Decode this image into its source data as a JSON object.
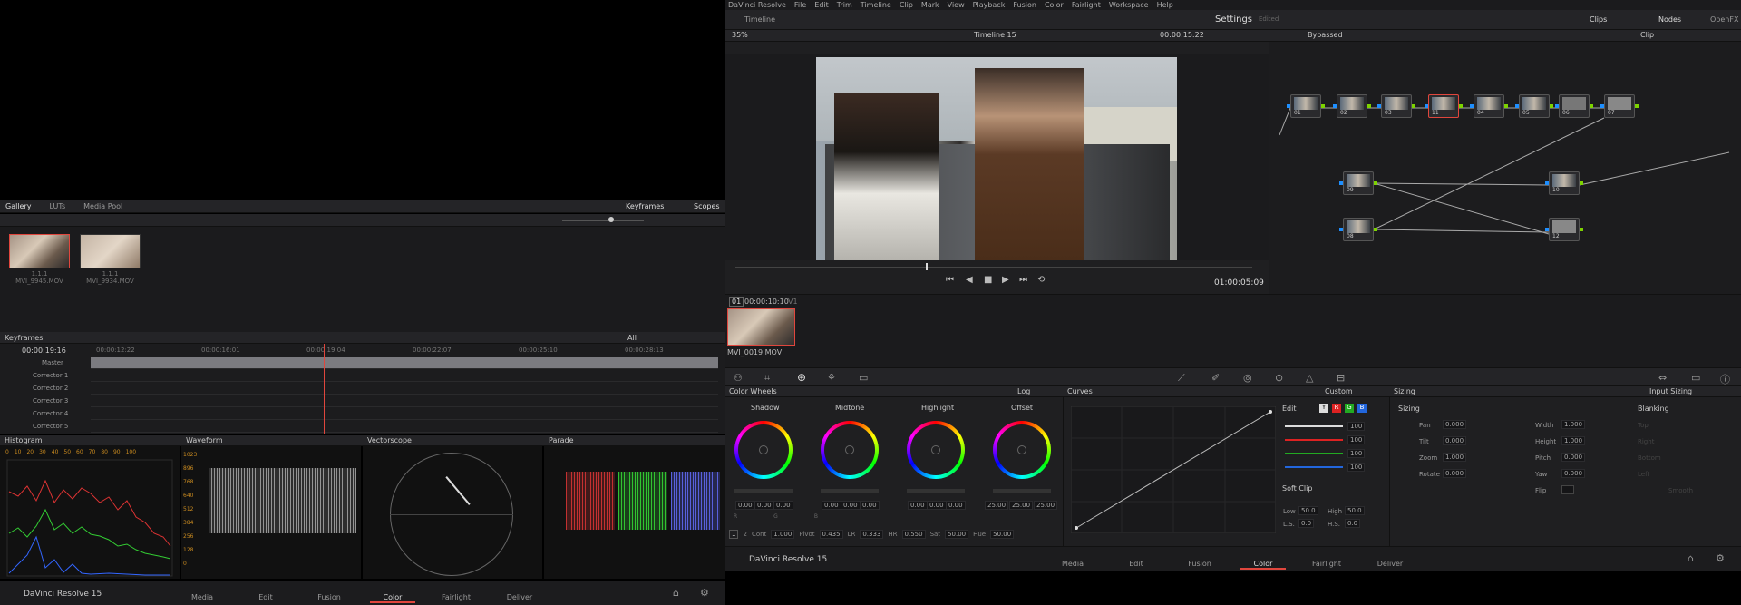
{
  "menu": [
    "DaVinci Resolve",
    "File",
    "Edit",
    "Trim",
    "Timeline",
    "Clip",
    "Mark",
    "View",
    "Playback",
    "Fusion",
    "Color",
    "Fairlight",
    "Workspace",
    "Help"
  ],
  "top": {
    "timeline_tab": "Timeline",
    "settings": "Settings",
    "edited": "Edited",
    "clips": "Clips",
    "nodes": "Nodes",
    "openfx": "OpenFX"
  },
  "viewer": {
    "zoom": "35%",
    "timeline_name": "Timeline 15",
    "timecode": "00:00:15:22",
    "playhead_tc": "01:00:05:09",
    "bypassed": "Bypassed",
    "clip_mode": "Clip"
  },
  "clip_strip": {
    "index": "01",
    "tc": "00:00:10:10",
    "track": "V1",
    "name": "MVI_0019.MOV"
  },
  "gallery": {
    "tabs": [
      "Gallery",
      "LUTs",
      "Media Pool"
    ],
    "keyframes": "Keyframes",
    "scopes": "Scopes",
    "stills": [
      {
        "id": "1.1.1",
        "name": "MVI_9945.MOV"
      },
      {
        "id": "1.1.1",
        "name": "MVI_9934.MOV"
      }
    ]
  },
  "keyframes": {
    "title": "Keyframes",
    "filter": "All",
    "tc": "00:00:19:16",
    "ruler": [
      "00:00:12:22",
      "00:00:16:01",
      "00:00:19:04",
      "00:00:22:07",
      "00:00:25:10",
      "00:00:28:13"
    ],
    "tracks": [
      "Master",
      "Corrector 1",
      "Corrector 2",
      "Corrector 3",
      "Corrector 4",
      "Corrector 5"
    ]
  },
  "scopes": [
    {
      "name": "Histogram"
    },
    {
      "name": "Waveform"
    },
    {
      "name": "Vectorscope"
    },
    {
      "name": "Parade"
    }
  ],
  "hist_axis": [
    "0",
    "10",
    "20",
    "30",
    "40",
    "50",
    "60",
    "70",
    "80",
    "90",
    "100"
  ],
  "wave_axis": [
    "1023",
    "896",
    "768",
    "640",
    "512",
    "384",
    "256",
    "128",
    "0"
  ],
  "bottom_nav": [
    "Media",
    "Edit",
    "Fusion",
    "Color",
    "Fairlight",
    "Deliver"
  ],
  "brand": "DaVinci Resolve 15",
  "wheels": {
    "title": "Color Wheels",
    "mode": "Log",
    "items": [
      {
        "name": "Shadow",
        "vals": [
          "0.00",
          "0.00",
          "0.00"
        ]
      },
      {
        "name": "Midtone",
        "vals": [
          "0.00",
          "0.00",
          "0.00"
        ]
      },
      {
        "name": "Highlight",
        "vals": [
          "0.00",
          "0.00",
          "0.00"
        ]
      },
      {
        "name": "Offset",
        "vals": [
          "25.00",
          "25.00",
          "25.00"
        ]
      }
    ],
    "rgb": [
      "R",
      "G",
      "B"
    ],
    "params": {
      "page1": "1",
      "page2": "2",
      "cont_l": "Cont",
      "cont": "1.000",
      "pivot_l": "Pivot",
      "pivot": "0.435",
      "lr_l": "LR",
      "lr": "0.333",
      "hr_l": "HR",
      "hr": "0.550",
      "sat_l": "Sat",
      "sat": "50.00",
      "hue_l": "Hue",
      "hue": "50.00"
    }
  },
  "curves": {
    "title": "Curves",
    "mode": "Custom",
    "edit": "Edit",
    "y": "Y",
    "r": "R",
    "g": "G",
    "b": "B",
    "values": [
      "100",
      "100",
      "100",
      "100"
    ],
    "softclip": "Soft Clip",
    "low_l": "Low",
    "low": "50.0",
    "high_l": "High",
    "high": "50.0",
    "ls_l": "L.S.",
    "ls": "0.0",
    "hs_l": "H.S.",
    "hs": "0.0"
  },
  "sizing": {
    "title": "Sizing",
    "mode": "Input Sizing",
    "sub": "Sizing",
    "blanking": "Blanking",
    "pan_l": "Pan",
    "pan": "0.000",
    "tilt_l": "Tilt",
    "tilt": "0.000",
    "zoom_l": "Zoom",
    "zoom": "1.000",
    "rotate_l": "Rotate",
    "rotate": "0.000",
    "width_l": "Width",
    "width": "1.000",
    "height_l": "Height",
    "height": "1.000",
    "pitch_l": "Pitch",
    "pitch": "0.000",
    "yaw_l": "Yaw",
    "yaw": "0.000",
    "flip_l": "Flip",
    "top": "Top",
    "right": "Right",
    "bottom": "Bottom",
    "left": "Left",
    "smooth": "Smooth"
  },
  "nodes": [
    "01",
    "02",
    "03",
    "11",
    "04",
    "05",
    "06",
    "07",
    "09",
    "10",
    "08",
    "12"
  ],
  "colors": {
    "accent": "#e0463d",
    "link": "#1e8fff",
    "ok": "#7dd300"
  }
}
